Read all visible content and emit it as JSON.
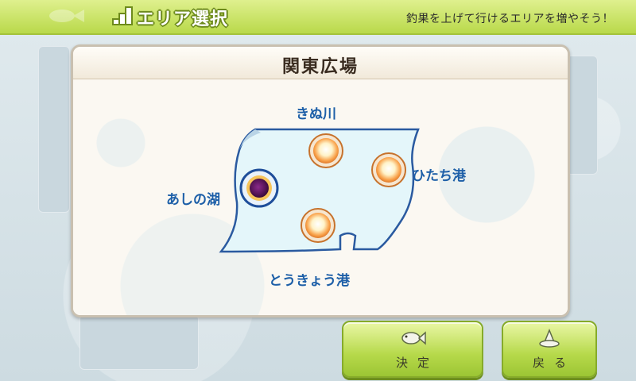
{
  "header": {
    "title": "エリア選択",
    "hint": "釣果を上げて行けるエリアを増やそう！"
  },
  "panel": {
    "title": "関東広場"
  },
  "map": {
    "spots": [
      {
        "label": "きぬ川",
        "state": "available"
      },
      {
        "label": "あしの湖",
        "state": "selected"
      },
      {
        "label": "ひたち港",
        "state": "available"
      },
      {
        "label": "とうきょう港",
        "state": "available"
      }
    ]
  },
  "buttons": {
    "confirm_label": "決定",
    "back_label": "戻る"
  },
  "colors": {
    "header_green": "#b9d94a",
    "label_blue": "#1d5fa8",
    "selected_spot": "#6a1a6a",
    "available_spot": "#f7a24a"
  },
  "icons": {
    "title": "stairs-icon",
    "confirm": "fish-icon",
    "back": "hat-icon"
  }
}
